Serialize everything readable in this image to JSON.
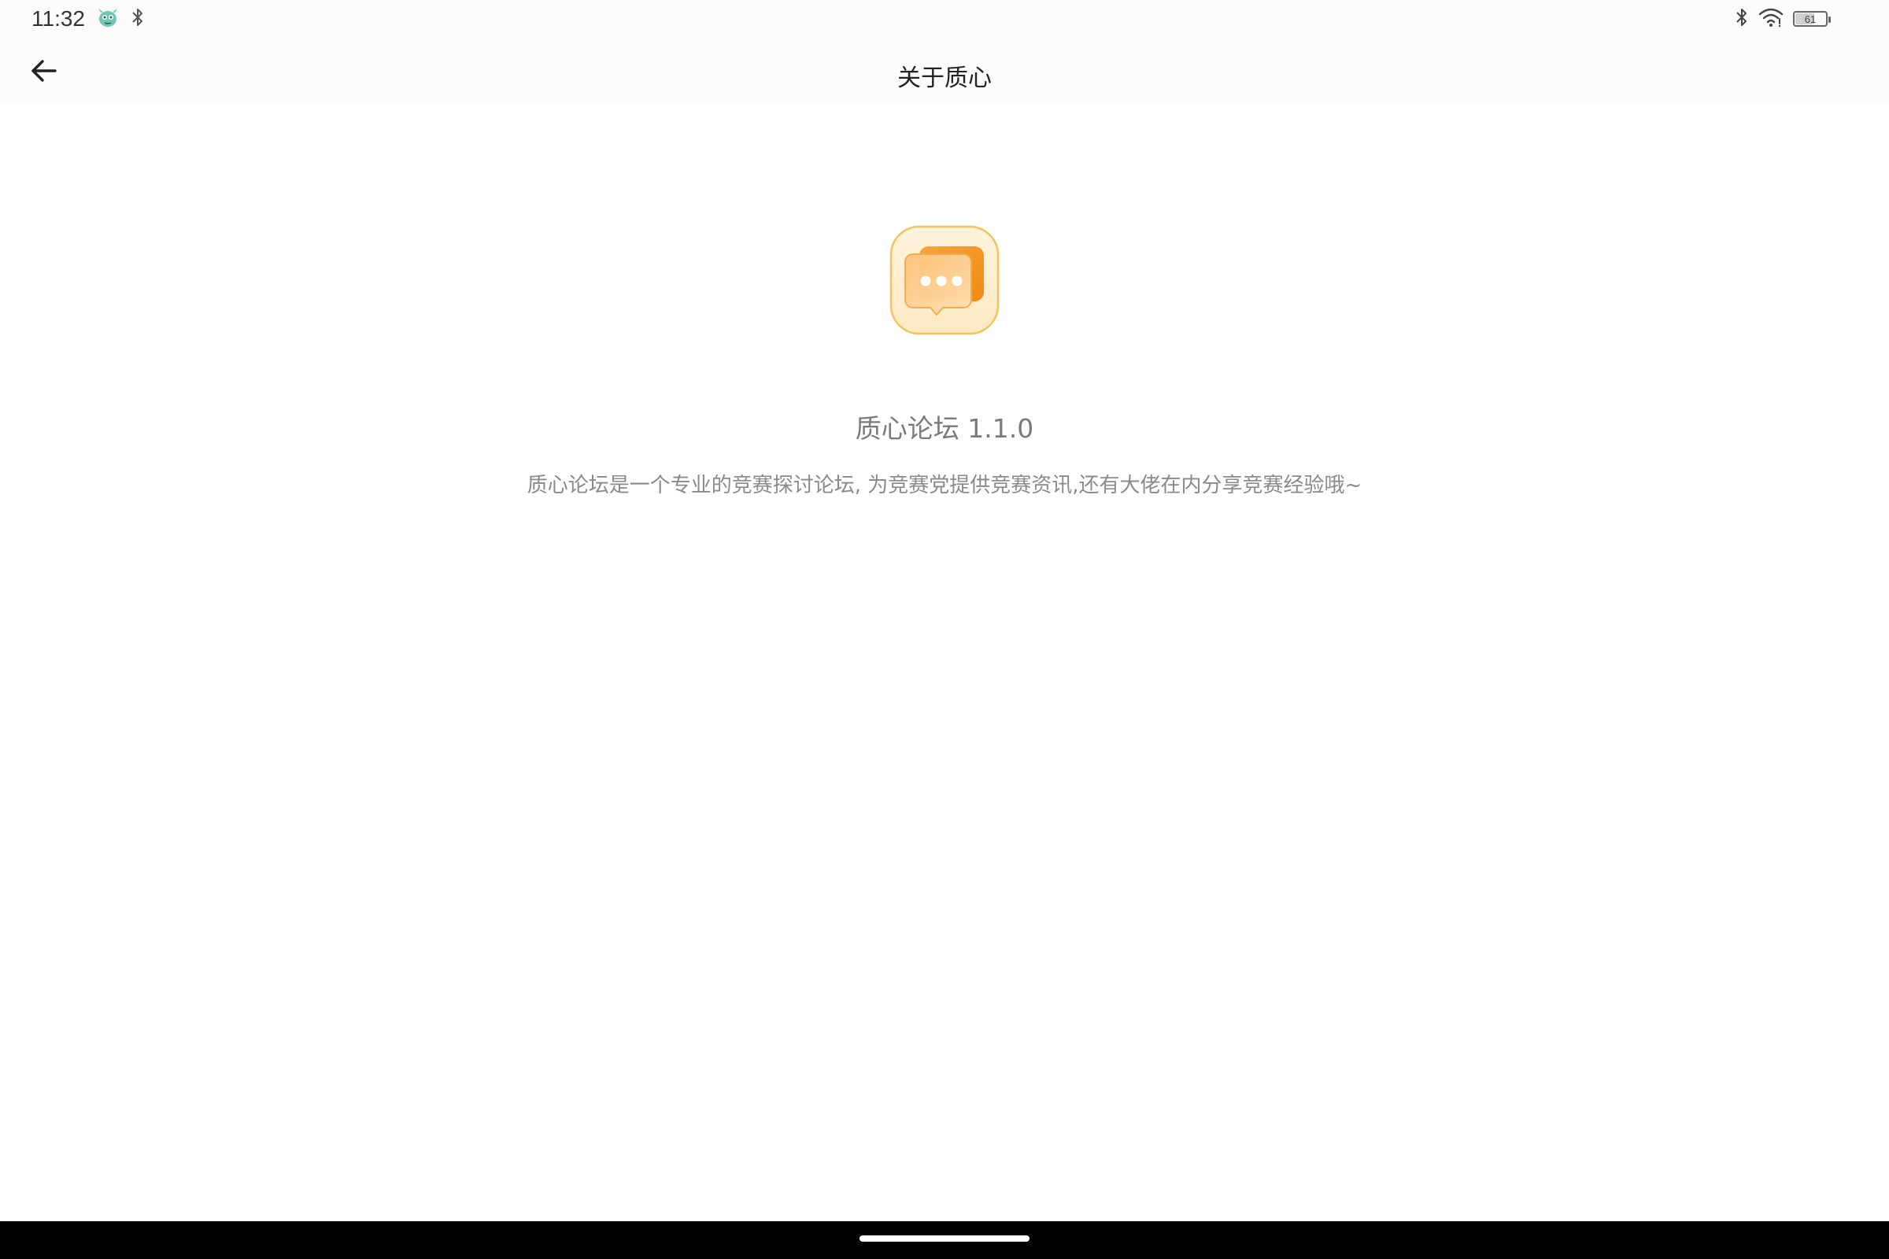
{
  "status_bar": {
    "time": "11:32",
    "battery_level": "61",
    "icons_left": [
      "alien-face-icon",
      "bluetooth-icon"
    ],
    "icons_right": [
      "bluetooth-icon",
      "wifi-icon",
      "battery-icon"
    ]
  },
  "app_bar": {
    "title": "关于质心",
    "back_icon": "arrow-left-icon"
  },
  "about": {
    "app_name_version": "质心论坛 1.1.0",
    "description": "质心论坛是一个专业的竞赛探讨论坛, 为竞赛党提供竞赛资讯,还有大佬在内分享竞赛经验哦~",
    "logo_icon": "chat-bubble-logo",
    "accent_color": "#f59a1f"
  },
  "nav_bar": {
    "home_indicator": "home-indicator"
  }
}
